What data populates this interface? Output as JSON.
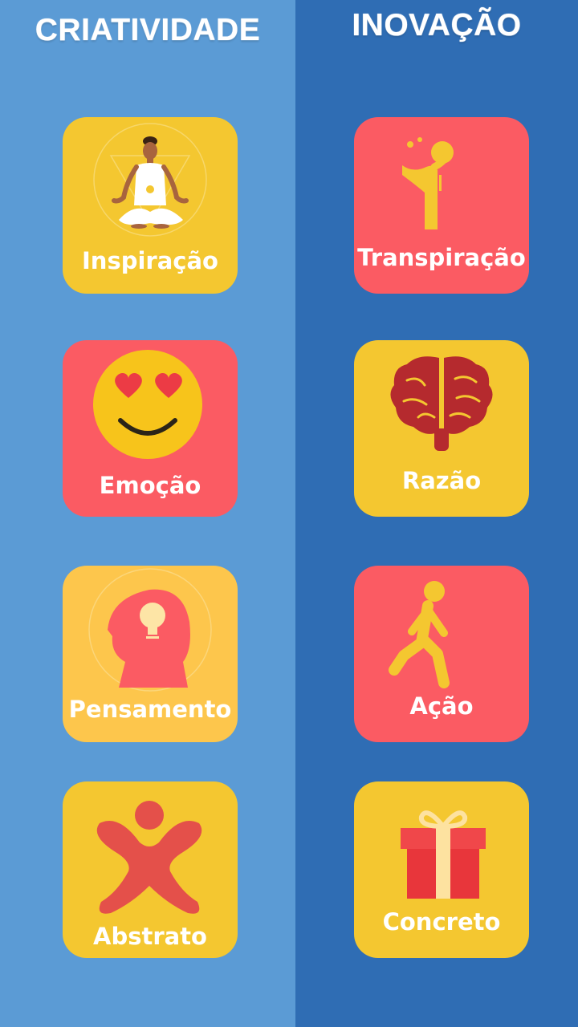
{
  "columns": {
    "left": {
      "title": "CRIATIVIDADE"
    },
    "right": {
      "title": "INOVAÇÃO"
    }
  },
  "cards": {
    "inspiracao": {
      "label": "Inspiração",
      "icon": "meditation-icon",
      "color": "#f4c730"
    },
    "emocao": {
      "label": "Emoção",
      "icon": "heart-eyes-emoji-icon",
      "color": "#fb5b63"
    },
    "pensamento": {
      "label": "Pensamento",
      "icon": "head-lightbulb-icon",
      "color": "#fdc64c"
    },
    "abstrato": {
      "label": "Abstrato",
      "icon": "abstract-figure-icon",
      "color": "#f4c730"
    },
    "transpiracao": {
      "label": "Transpiração",
      "icon": "sweating-person-icon",
      "color": "#fb5b63"
    },
    "razao": {
      "label": "Razão",
      "icon": "brain-icon",
      "color": "#f4c730"
    },
    "acao": {
      "label": "Ação",
      "icon": "walking-person-icon",
      "color": "#fb5b63"
    },
    "concreto": {
      "label": "Concreto",
      "icon": "gift-box-icon",
      "color": "#f4c730"
    }
  },
  "colors": {
    "left_bg": "#5b9bd5",
    "right_bg": "#2f6db4",
    "yellow": "#f4c730",
    "red": "#fb5b63",
    "text": "#ffffff"
  }
}
